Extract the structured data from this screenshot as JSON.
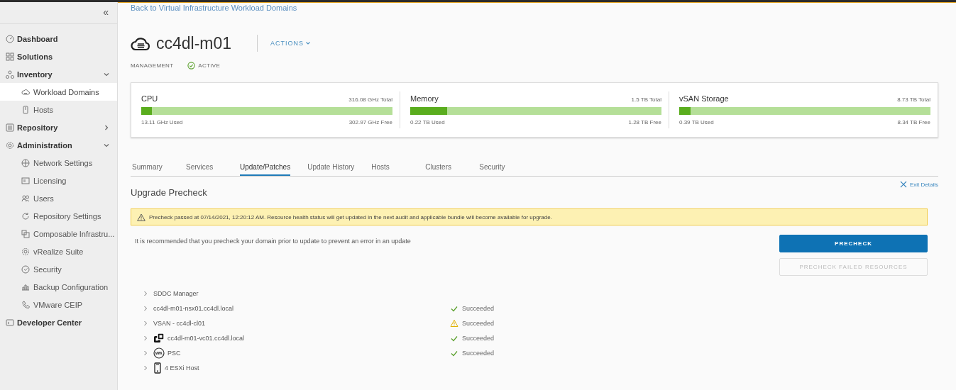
{
  "sidebar": {
    "collapse_label": "«",
    "items": [
      {
        "label": "Dashboard",
        "kind": "section"
      },
      {
        "label": "Solutions",
        "kind": "section"
      },
      {
        "label": "Inventory",
        "kind": "section",
        "expanded": true,
        "children": [
          {
            "label": "Workload Domains",
            "selected": true
          },
          {
            "label": "Hosts",
            "selected": false
          }
        ]
      },
      {
        "label": "Repository",
        "kind": "section",
        "expanded": false
      },
      {
        "label": "Administration",
        "kind": "section",
        "expanded": true,
        "children": [
          {
            "label": "Network Settings",
            "selected": false
          },
          {
            "label": "Licensing",
            "selected": false
          },
          {
            "label": "Users",
            "selected": false
          },
          {
            "label": "Repository Settings",
            "selected": false
          },
          {
            "label": "Composable Infrastru...",
            "selected": false
          },
          {
            "label": "vRealize Suite",
            "selected": false
          },
          {
            "label": "Security",
            "selected": false
          },
          {
            "label": "Backup Configuration",
            "selected": false
          },
          {
            "label": "VMware CEIP",
            "selected": false
          }
        ]
      },
      {
        "label": "Developer Center",
        "kind": "section"
      }
    ]
  },
  "back_link": "Back to Virtual Infrastructure Workload Domains",
  "domain": {
    "name": "cc4dl-m01",
    "actions": "ACTIONS",
    "type": "MANAGEMENT",
    "status": "ACTIVE"
  },
  "resources": [
    {
      "name": "CPU",
      "total": "316.08 GHz Total",
      "used": "13.11 GHz Used",
      "free": "302.97 GHz Free",
      "level": 0.041
    },
    {
      "name": "Memory",
      "total": "1.5 TB Total",
      "used": "0.22 TB Used",
      "free": "1.28 TB Free",
      "level": 0.147
    },
    {
      "name": "vSAN Storage",
      "total": "8.73 TB Total",
      "used": "0.39 TB Used",
      "free": "8.34 TB Free",
      "level": 0.045
    }
  ],
  "tabs": [
    {
      "label": "Summary",
      "selected": false
    },
    {
      "label": "Services",
      "selected": false
    },
    {
      "label": "Update/Patches",
      "selected": true
    },
    {
      "label": "Update History",
      "selected": false
    },
    {
      "label": "Hosts",
      "selected": false
    },
    {
      "label": "Clusters",
      "selected": false
    },
    {
      "label": "Security",
      "selected": false
    }
  ],
  "exit_details": "Exit Details",
  "section_title": "Upgrade Precheck",
  "alert": "Precheck passed at 07/14/2021, 12:20:12 AM. Resource health status will get updated in the next audit and applicable bundle will become available for upgrade.",
  "recommendation": "It is recommended that you precheck your domain prior to update to prevent an error in an update",
  "buttons": [
    {
      "label": "PRECHECK",
      "disabled": false
    },
    {
      "label": "PRECHECK FAILED RESOURCES",
      "disabled": true
    }
  ],
  "results": [
    {
      "name": "SDDC Manager",
      "kind": "plain"
    },
    {
      "name": "cc4dl-m01-nsx01.cc4dl.local",
      "kind": "plain",
      "warning": false,
      "status_text": "Succeeded"
    },
    {
      "name": "VSAN - cc4dl-cl01",
      "kind": "plain",
      "warning": true,
      "status_text": "Succeeded"
    },
    {
      "name": "cc4dl-m01-vc01.cc4dl.local",
      "kind": "vcenter",
      "warning": false,
      "status_text": "Succeeded"
    },
    {
      "name": "PSC",
      "kind": "psc",
      "warning": false,
      "status_text": "Succeeded"
    },
    {
      "name": "4 ESXi Host",
      "kind": "host"
    }
  ]
}
